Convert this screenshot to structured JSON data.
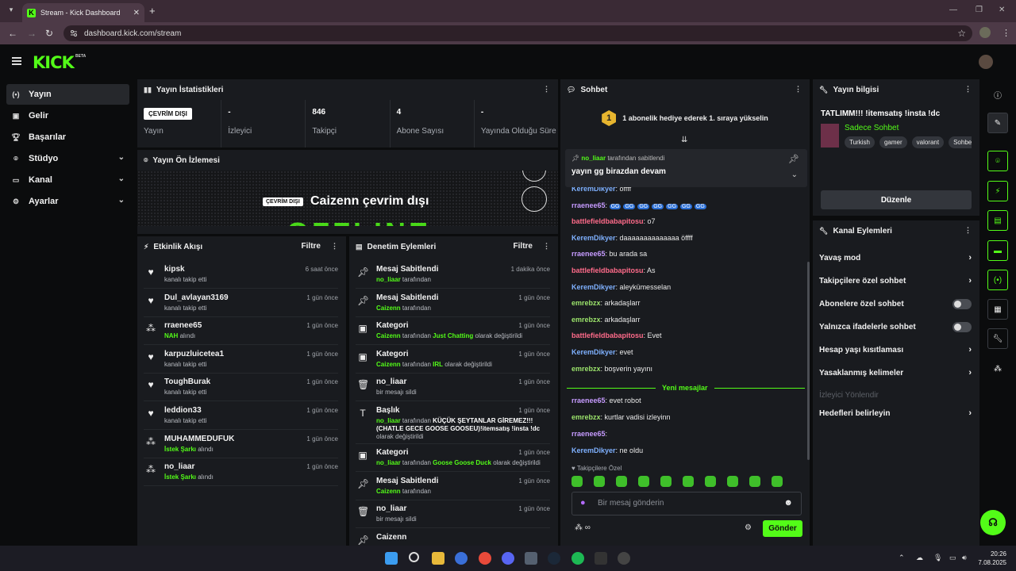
{
  "browser": {
    "tab_title": "Stream - Kick Dashboard",
    "url": "dashboard.kick.com/stream"
  },
  "header": {
    "logo": "KICK",
    "beta": "BETA"
  },
  "sidebar": {
    "items": [
      {
        "label": "Yayın",
        "icon": "broadcast-icon",
        "active": true
      },
      {
        "label": "Gelir",
        "icon": "revenue-icon"
      },
      {
        "label": "Başarılar",
        "icon": "trophy-icon"
      },
      {
        "label": "Stüdyo",
        "icon": "studio-icon",
        "expandable": true
      },
      {
        "label": "Kanal",
        "icon": "channel-icon",
        "expandable": true
      },
      {
        "label": "Ayarlar",
        "icon": "gear-icon",
        "expandable": true
      }
    ]
  },
  "stats": {
    "title": "Yayın İstatistikleri",
    "items": [
      {
        "value": "ÇEVRİM DIŞI",
        "label": "Yayın",
        "badge": true
      },
      {
        "value": "-",
        "label": "İzleyici"
      },
      {
        "value": "846",
        "label": "Takipçi"
      },
      {
        "value": "4",
        "label": "Abone Sayısı"
      },
      {
        "value": "-",
        "label": "Yayında Olduğu Süre"
      }
    ]
  },
  "preview": {
    "title": "Yayın Ön İzlemesi",
    "badge": "ÇEVRİM DIŞI",
    "status": "Caizenn çevrim dışı",
    "bg_text": "OFFLINE"
  },
  "activity": {
    "title": "Etkinlik Akışı",
    "filter": "Filtre",
    "items": [
      {
        "name": "kipsk",
        "sub": "kanalı takip etti",
        "time": "6 saat önce",
        "icon": "heart-icon"
      },
      {
        "name": "Dul_avlayan3169",
        "sub": "kanalı takip etti",
        "time": "1 gün önce",
        "icon": "heart-icon"
      },
      {
        "name": "rraenee65",
        "sub_hl": "NAH",
        "sub": "alındı",
        "time": "1 gün önce",
        "icon": "redeem-icon"
      },
      {
        "name": "karpuzluicetea1",
        "sub": "kanalı takip etti",
        "time": "1 gün önce",
        "icon": "heart-icon"
      },
      {
        "name": "ToughBurak",
        "sub": "kanalı takip etti",
        "time": "1 gün önce",
        "icon": "heart-icon"
      },
      {
        "name": "leddion33",
        "sub": "kanalı takip etti",
        "time": "1 gün önce",
        "icon": "heart-icon"
      },
      {
        "name": "MUHAMMEDUFUK",
        "sub_hl": "İstek Şarkı",
        "sub": "alındı",
        "time": "1 gün önce",
        "icon": "redeem-icon"
      },
      {
        "name": "no_liaar",
        "sub_hl": "İstek Şarkı",
        "sub": "alındı",
        "time": "1 gün önce",
        "icon": "redeem-icon"
      }
    ]
  },
  "moderation": {
    "title": "Denetim Eylemleri",
    "filter": "Filtre",
    "items": [
      {
        "name": "Mesaj Sabitlendi",
        "who": "no_liaar",
        "rest": "tarafından",
        "time": "1 dakika önce",
        "icon": "pin-icon"
      },
      {
        "name": "Mesaj Sabitlendi",
        "who": "Caizenn",
        "rest": "tarafından",
        "time": "1 gün önce",
        "icon": "pin-icon"
      },
      {
        "name": "Kategori",
        "who": "Caizenn",
        "rest": "tarafından",
        "hl": "Just Chatting",
        "rest2": "olarak değiştirildi",
        "time": "1 gün önce",
        "icon": "category-icon"
      },
      {
        "name": "Kategori",
        "who": "Caizenn",
        "rest": "tarafından",
        "hl": "IRL",
        "rest2": "olarak değiştirildi",
        "time": "1 gün önce",
        "icon": "category-icon"
      },
      {
        "name": "no_liaar",
        "plain": "bir mesajı sildi",
        "time": "1 gün önce",
        "icon": "trash-icon"
      },
      {
        "name": "Başlık",
        "who": "no_liaar",
        "rest": "tarafından",
        "white": "KÜÇÜK ŞEYTANLAR GİREMEZ!!! (CHATLE GECE GOOSE GOOSEU)!itemsatış !insta !dc",
        "rest2": "olarak değiştirildi",
        "time": "1 gün önce",
        "icon": "title-icon"
      },
      {
        "name": "Kategori",
        "who": "no_liaar",
        "rest": "tarafından",
        "hl": "Goose Goose Duck",
        "rest2": "olarak değiştirildi",
        "time": "1 gün önce",
        "icon": "category-icon"
      },
      {
        "name": "Mesaj Sabitlendi",
        "who": "Caizenn",
        "rest": "tarafından",
        "time": "1 gün önce",
        "icon": "pin-icon"
      },
      {
        "name": "no_liaar",
        "plain": "bir mesajı sildi",
        "time": "1 gün önce",
        "icon": "trash-icon"
      },
      {
        "name": "Caizenn",
        "plain": "",
        "time": "",
        "icon": "pin-icon"
      }
    ]
  },
  "chat": {
    "title": "Sohbet",
    "banner_num": "1",
    "banner": "1 abonelik hediye ederek 1. sıraya yükselin",
    "pinned_by": "no_liaar",
    "pinned_rest": "tarafından sabitlendi",
    "pinned_msg": "yayın gg birazdan devam",
    "messages": [
      {
        "user": "KeremDikyer",
        "text": "offff",
        "color": "#7fb1ff"
      },
      {
        "user": "rraenee65",
        "text": "",
        "color": "#c69bff",
        "emotes": 7
      },
      {
        "user": "battlefieldbabapitosu",
        "text": "o7",
        "color": "#ff6b8a"
      },
      {
        "user": "KeremDikyer",
        "text": "daaaaaaaaaaaaaa öffff",
        "color": "#7fb1ff"
      },
      {
        "user": "rraenee65",
        "text": "bu arada sa",
        "color": "#c69bff"
      },
      {
        "user": "battlefieldbabapitosu",
        "text": "As",
        "color": "#ff6b8a"
      },
      {
        "user": "KeremDikyer",
        "text": "aleykümesselan",
        "color": "#7fb1ff"
      },
      {
        "user": "emrebzx",
        "text": "arkadaşlarr",
        "color": "#9be36b"
      },
      {
        "user": "emrebzx",
        "text": "arkadaşlarr",
        "color": "#9be36b"
      },
      {
        "user": "battlefieldbabapitosu",
        "text": "Evet",
        "color": "#ff6b8a"
      },
      {
        "user": "KeremDikyer",
        "text": "evet",
        "color": "#7fb1ff"
      },
      {
        "user": "emrebzx",
        "text": "boşverin yayını",
        "color": "#9be36b"
      }
    ],
    "new_label": "Yeni mesajlar",
    "new_messages": [
      {
        "user": "rraenee65",
        "text": "evet robot",
        "color": "#c69bff"
      },
      {
        "user": "emrebzx",
        "text": "kurtlar vadisi izleyinn",
        "color": "#9be36b"
      },
      {
        "user": "rraenee65",
        "text": "",
        "color": "#c69bff"
      },
      {
        "user": "KeremDikyer",
        "text": "ne oldu",
        "color": "#7fb1ff"
      }
    ],
    "follow_only": "Takipçilere Özel",
    "placeholder": "Bir mesaj gönderin",
    "send": "Gönder",
    "points": "∞"
  },
  "info": {
    "title": "Yayın bilgisi",
    "stream_title": "TATLIMM!!! !itemsatış !insta !dc",
    "category": "Sadece Sohbet",
    "tags": [
      "Turkish",
      "gamer",
      "valorant",
      "Sohbet"
    ],
    "edit": "Düzenle"
  },
  "actions": {
    "title": "Kanal Eylemleri",
    "items": [
      {
        "label": "Yavaş mod",
        "type": "chevron"
      },
      {
        "label": "Takipçilere özel sohbet",
        "type": "chevron"
      },
      {
        "label": "Abonelere özel sohbet",
        "type": "toggle"
      },
      {
        "label": "Yalnızca ifadelerle sohbet",
        "type": "toggle"
      },
      {
        "label": "Hesap yaşı kısıtlaması",
        "type": "chevron"
      },
      {
        "label": "Yasaklanmış kelimeler",
        "type": "chevron"
      },
      {
        "label": "İzleyici Yönlendir",
        "type": "disabled"
      },
      {
        "label": "Hedefleri belirleyin",
        "type": "chevron"
      }
    ]
  },
  "taskbar": {
    "time": "20:26",
    "date": "7.08.2025"
  },
  "colors": {
    "accent": "#53fc18",
    "panel": "#191b1f",
    "bg": "#0b0c0d"
  }
}
